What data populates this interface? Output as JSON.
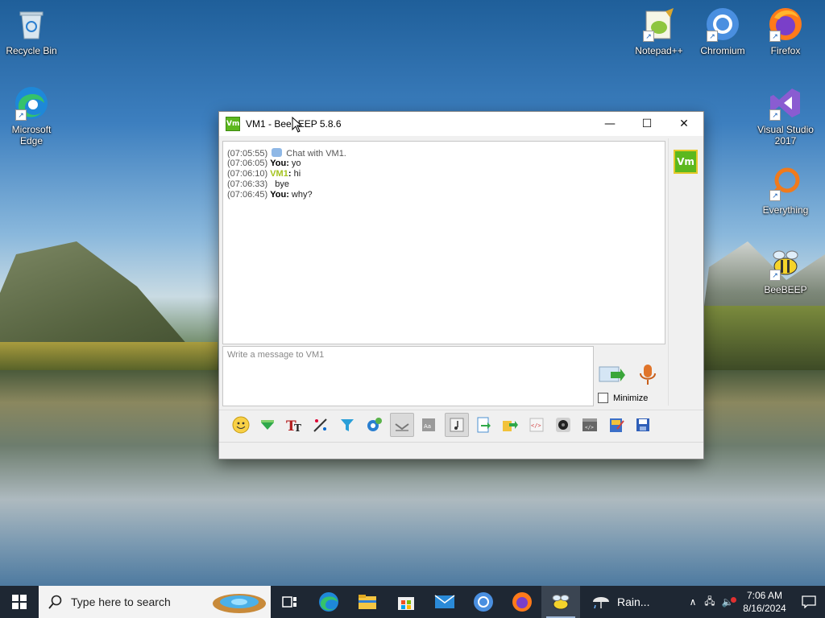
{
  "desktop": {
    "icons": [
      {
        "label": "Recycle Bin",
        "icon": "recycle-bin-icon"
      },
      {
        "label": "Microsoft Edge",
        "icon": "edge-icon"
      },
      {
        "label": "Notepad++",
        "icon": "notepadpp-icon"
      },
      {
        "label": "Chromium",
        "icon": "chromium-icon"
      },
      {
        "label": "Firefox",
        "icon": "firefox-icon"
      },
      {
        "label": "Visual Studio 2017",
        "icon": "visual-studio-icon"
      },
      {
        "label": "Everything",
        "icon": "everything-icon"
      },
      {
        "label": "BeeBEEP",
        "icon": "beebeep-icon"
      }
    ]
  },
  "window": {
    "app_badge": "Vm",
    "title": "VM1 - BeeBEEP 5.8.6",
    "controls": {
      "minimize": "—",
      "maximize": "☐",
      "close": "✕"
    },
    "chat": [
      {
        "time": "(07:05:55)",
        "sender": "",
        "text": "Chat with VM1."
      },
      {
        "time": "(07:06:05)",
        "sender": "You",
        "text": "yo"
      },
      {
        "time": "(07:06:10)",
        "sender": "VM1",
        "text": "hi"
      },
      {
        "time": "(07:06:33)",
        "sender": "",
        "text": "bye"
      },
      {
        "time": "(07:06:45)",
        "sender": "You",
        "text": "why?"
      }
    ],
    "avatar": "Vm",
    "input_placeholder": "Write a message to VM1",
    "minimize_label": "Minimize",
    "toolbar": [
      "emoji-icon",
      "send-file-down-icon",
      "font-icon",
      "color-picker-icon",
      "filter-icon",
      "settings-icon",
      "compact-view-icon",
      "background-icon",
      "sound-icon",
      "export-icon",
      "share-icon",
      "html-icon",
      "camera-icon",
      "code-icon",
      "notes-icon",
      "save-icon"
    ]
  },
  "taskbar": {
    "search_placeholder": "Type here to search",
    "weather_label": "Rain...",
    "time": "7:06 AM",
    "date": "8/16/2024"
  },
  "colors": {
    "taskbar_bg": "#1e2733",
    "vm_accent": "#a4c31e",
    "app_green": "#5cb81e"
  }
}
